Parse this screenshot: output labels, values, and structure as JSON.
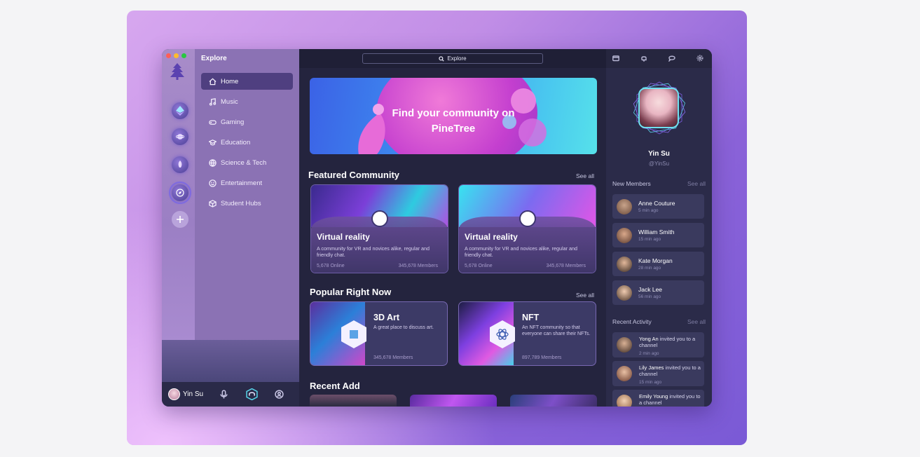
{
  "app": {
    "section_title": "Explore",
    "search_placeholder": "Explore"
  },
  "nav": [
    {
      "label": "Home",
      "icon": "home-icon"
    },
    {
      "label": "Music",
      "icon": "music-icon"
    },
    {
      "label": "Gaming",
      "icon": "gamepad-icon"
    },
    {
      "label": "Education",
      "icon": "graduation-cap-icon"
    },
    {
      "label": "Science & Tech",
      "icon": "globe-icon"
    },
    {
      "label": "Entertainment",
      "icon": "smiley-icon"
    },
    {
      "label": "Student Hubs",
      "icon": "cube-icon"
    }
  ],
  "user": {
    "name": "Yin Su",
    "handle": "@YinSu"
  },
  "hero": {
    "text_line1": "Find your community on",
    "text_line2": "PineTree"
  },
  "featured": {
    "title": "Featured Community",
    "see_all": "See all",
    "cards": [
      {
        "title": "Virtual reality",
        "desc": "A community for VR and novices alike, regular and friendly chat.",
        "online": "5,678 Online",
        "members": "345,678 Members"
      },
      {
        "title": "Virtual reality",
        "desc": "A community for VR and novices alike, regular and friendly chat.",
        "online": "5,678 Online",
        "members": "345,678 Members"
      }
    ]
  },
  "popular": {
    "title": "Popular Right Now",
    "see_all": "See all",
    "cards": [
      {
        "title": "3D Art",
        "desc": "A great place to discuss art.",
        "members": "345,678 Members"
      },
      {
        "title": "NFT",
        "desc": "An NFT community so that everyone can share their NFTs.",
        "members": "897,789 Members"
      }
    ]
  },
  "recent_add": {
    "title": "Recent Add"
  },
  "new_members": {
    "title": "New Members",
    "see_all": "See all",
    "items": [
      {
        "name": "Anne Couture",
        "time": "5 min ago"
      },
      {
        "name": "William Smith",
        "time": "15 min ago"
      },
      {
        "name": "Kate Morgan",
        "time": "28 min ago"
      },
      {
        "name": "Jack Lee",
        "time": "56 min ago"
      }
    ]
  },
  "recent_activity": {
    "title": "Recent Activity",
    "see_all": "See all",
    "items": [
      {
        "name": "Yong An",
        "action": "invited you to a channel",
        "time": "2 min ago"
      },
      {
        "name": "Lily James",
        "action": "invited you to a channel",
        "time": "15 min ago"
      },
      {
        "name": "Emily Young",
        "action": "invited you to a channel",
        "time": ""
      }
    ]
  },
  "colors": {
    "accent": "#4f3f80",
    "background": "#24243e",
    "sidebar": "#8b72b4",
    "hero_start": "#3b62e6",
    "hero_end": "#56e1ea"
  }
}
